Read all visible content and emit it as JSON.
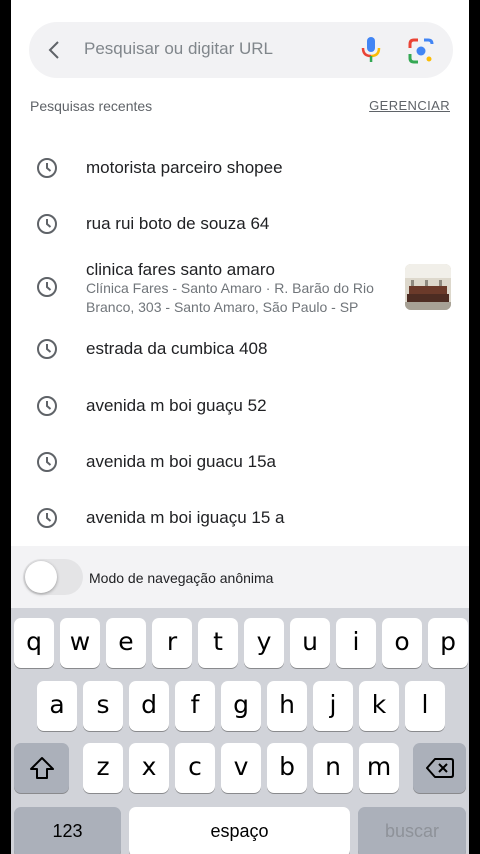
{
  "search": {
    "placeholder": "Pesquisar ou digitar URL"
  },
  "recent": {
    "header": "Pesquisas recentes",
    "manage_label": "GERENCIAR",
    "items": [
      {
        "title": "motorista parceiro shopee"
      },
      {
        "title": "rua rui boto de souza 64"
      },
      {
        "title": "clinica fares santo amaro",
        "subtitle": "Clínica Fares - Santo Amaro · R. Barão do Rio Branco, 303 - Santo Amaro, São Paulo - SP"
      },
      {
        "title": "estrada da cumbica 408"
      },
      {
        "title": "avenida m boi guaçu 52"
      },
      {
        "title": "avenida m boi guacu 15a"
      },
      {
        "title": "avenida m boi iguaçu 15 a"
      }
    ]
  },
  "incognito": {
    "label": "Modo de navegação anônima",
    "enabled": false
  },
  "keyboard": {
    "row1": [
      "q",
      "w",
      "e",
      "r",
      "t",
      "y",
      "u",
      "i",
      "o",
      "p"
    ],
    "row2": [
      "a",
      "s",
      "d",
      "f",
      "g",
      "h",
      "j",
      "k",
      "l"
    ],
    "row3": [
      "z",
      "x",
      "c",
      "v",
      "b",
      "n",
      "m"
    ],
    "numbers_label": "123",
    "space_label": "espaço",
    "search_label": "buscar"
  },
  "colors": {
    "mic_blue": "#4285f4",
    "mic_red": "#ea4335",
    "mic_yellow": "#fbbc05",
    "mic_green": "#34a853"
  }
}
